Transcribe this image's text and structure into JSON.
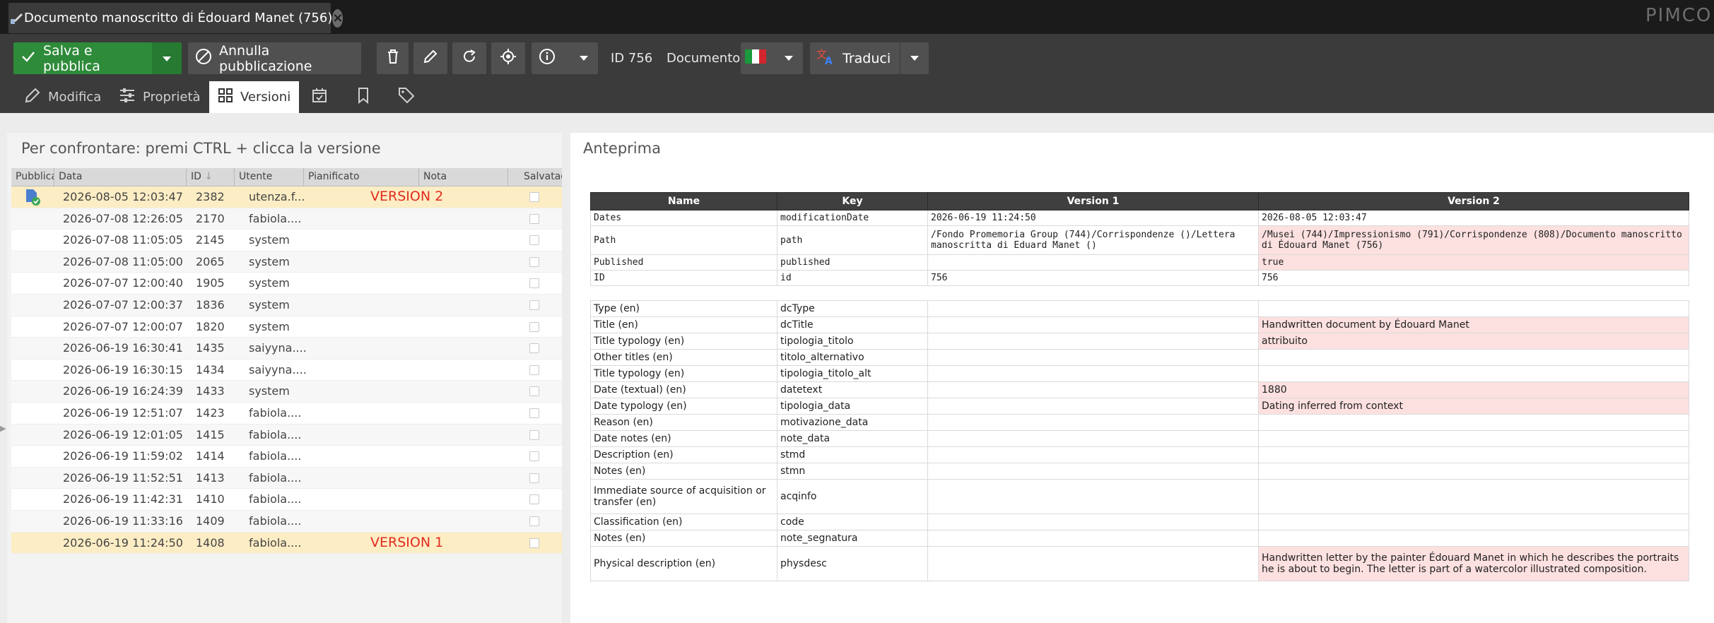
{
  "window": {
    "tab_title": "Documento manoscritto di Édouard Manet (756)",
    "tab_close": "×",
    "brand": "PIMCORE"
  },
  "toolbar": {
    "save_publish": "Salva e pubblica",
    "unpublish": "Annulla pubblicazione",
    "id_label": "ID 756",
    "type_label": "Documento",
    "language_flag": "Italian flag",
    "translate": "Traduci"
  },
  "subtabs": {
    "edit": "Modifica",
    "properties": "Proprietà",
    "versions": "Versioni"
  },
  "versions_panel": {
    "title": "Per confrontare: premi CTRL + clicca la versione",
    "columns": [
      "Pubblicato",
      "Data",
      "ID",
      "Utente",
      "Pianificato",
      "Nota",
      "Salvataggio"
    ],
    "rows": [
      {
        "date": "2026-08-05 12:03:47",
        "id": "2382",
        "user": "utenza.f...",
        "note": "VERSION 2",
        "published": true,
        "highlight": true
      },
      {
        "date": "2026-07-08 12:26:05",
        "id": "2170",
        "user": "fabiola....",
        "note": "",
        "published": false,
        "highlight": false
      },
      {
        "date": "2026-07-08 11:05:05",
        "id": "2145",
        "user": "system",
        "note": "",
        "published": false,
        "highlight": false
      },
      {
        "date": "2026-07-08 11:05:00",
        "id": "2065",
        "user": "system",
        "note": "",
        "published": false,
        "highlight": false
      },
      {
        "date": "2026-07-07 12:00:40",
        "id": "1905",
        "user": "system",
        "note": "",
        "published": false,
        "highlight": false
      },
      {
        "date": "2026-07-07 12:00:37",
        "id": "1836",
        "user": "system",
        "note": "",
        "published": false,
        "highlight": false
      },
      {
        "date": "2026-07-07 12:00:07",
        "id": "1820",
        "user": "system",
        "note": "",
        "published": false,
        "highlight": false
      },
      {
        "date": "2026-06-19 16:30:41",
        "id": "1435",
        "user": "saiyyna....",
        "note": "",
        "published": false,
        "highlight": false
      },
      {
        "date": "2026-06-19 16:30:15",
        "id": "1434",
        "user": "saiyyna....",
        "note": "",
        "published": false,
        "highlight": false
      },
      {
        "date": "2026-06-19 16:24:39",
        "id": "1433",
        "user": "system",
        "note": "",
        "published": false,
        "highlight": false
      },
      {
        "date": "2026-06-19 12:51:07",
        "id": "1423",
        "user": "fabiola....",
        "note": "",
        "published": false,
        "highlight": false
      },
      {
        "date": "2026-06-19 12:01:05",
        "id": "1415",
        "user": "fabiola....",
        "note": "",
        "published": false,
        "highlight": false
      },
      {
        "date": "2026-06-19 11:59:02",
        "id": "1414",
        "user": "fabiola....",
        "note": "",
        "published": false,
        "highlight": false
      },
      {
        "date": "2026-06-19 11:52:51",
        "id": "1413",
        "user": "fabiola....",
        "note": "",
        "published": false,
        "highlight": false
      },
      {
        "date": "2026-06-19 11:42:31",
        "id": "1410",
        "user": "fabiola....",
        "note": "",
        "published": false,
        "highlight": false
      },
      {
        "date": "2026-06-19 11:33:16",
        "id": "1409",
        "user": "fabiola....",
        "note": "",
        "published": false,
        "highlight": false
      },
      {
        "date": "2026-06-19 11:24:50",
        "id": "1408",
        "user": "fabiola....",
        "note": "VERSION 1",
        "published": false,
        "highlight": true
      }
    ]
  },
  "preview_panel": {
    "title": "Anteprima",
    "headers": [
      "Name",
      "Key",
      "Version 1",
      "Version 2"
    ],
    "system_rows": [
      {
        "name": "Dates",
        "key": "modificationDate",
        "v1": "2026-06-19 11:24:50",
        "v2": "2026-08-05 12:03:47",
        "diff": false
      },
      {
        "name": "Path",
        "key": "path",
        "v1": "/Fondo Promemoria Group (744)/Corrispondenze ()/Lettera manoscritta di Eduard Manet ()",
        "v2": "/Musei (744)/Impressionismo (791)/Corrispondenze (808)/Documento manoscritto di Édouard Manet (756)",
        "diff": true
      },
      {
        "name": "Published",
        "key": "published",
        "v1": "",
        "v2": "true",
        "diff": true
      },
      {
        "name": "ID",
        "key": "id",
        "v1": "756",
        "v2": "756",
        "diff": false
      }
    ],
    "field_rows": [
      {
        "name": "Type (en)",
        "key": "dcType",
        "v1": "",
        "v2": "",
        "diff": false
      },
      {
        "name": "Title (en)",
        "key": "dcTitle",
        "v1": "",
        "v2": "Handwritten document by Édouard Manet",
        "diff": true
      },
      {
        "name": "Title typology (en)",
        "key": "tipologia_titolo",
        "v1": "",
        "v2": "attribuito",
        "diff": true
      },
      {
        "name": "Other titles (en)",
        "key": "titolo_alternativo",
        "v1": "",
        "v2": "",
        "diff": false
      },
      {
        "name": "Title typology (en)",
        "key": "tipologia_titolo_alt",
        "v1": "",
        "v2": "",
        "diff": false
      },
      {
        "name": "Date (textual) (en)",
        "key": "datetext",
        "v1": "",
        "v2": "1880",
        "diff": true
      },
      {
        "name": "Date typology (en)",
        "key": "tipologia_data",
        "v1": "",
        "v2": "Dating inferred from context",
        "diff": true
      },
      {
        "name": "Reason (en)",
        "key": "motivazione_data",
        "v1": "",
        "v2": "",
        "diff": false
      },
      {
        "name": "Date notes (en)",
        "key": "note_data",
        "v1": "",
        "v2": "",
        "diff": false
      },
      {
        "name": "Description (en)",
        "key": "stmd",
        "v1": "",
        "v2": "",
        "diff": false
      },
      {
        "name": "Notes (en)",
        "key": "stmn",
        "v1": "",
        "v2": "",
        "diff": false
      },
      {
        "name": "Immediate source of acquisition or transfer (en)",
        "key": "acqinfo",
        "v1": "",
        "v2": "",
        "diff": false
      },
      {
        "name": "Classification (en)",
        "key": "code",
        "v1": "",
        "v2": "",
        "diff": false
      },
      {
        "name": "Notes (en)",
        "key": "note_segnatura",
        "v1": "",
        "v2": "",
        "diff": false
      },
      {
        "name": "Physical description (en)",
        "key": "physdesc",
        "v1": "",
        "v2": "Handwritten letter by the painter Édouard Manet in which he describes the portraits he is about to begin. The letter is part of a watercolor illustrated composition.",
        "diff": true
      }
    ]
  },
  "colors": {
    "save_green": "#2e8b3a",
    "toolbar_bg": "#3b3b3b",
    "highlight_row": "#fcedc4",
    "diff_cell": "#fde0e0",
    "note_red": "#e32b1e"
  }
}
